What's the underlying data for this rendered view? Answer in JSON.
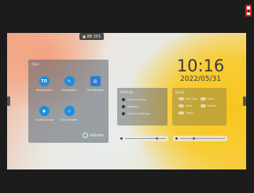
{
  "header": {
    "label": "88 201"
  },
  "clock": {
    "time": "10:16",
    "date": "2022/05/31"
  },
  "apps_panel": {
    "title": "Apps",
    "apps": [
      {
        "icon_text": "TO",
        "label": "Whiteboard",
        "icon": "whiteboard-icon"
      },
      {
        "icon_text": "✎",
        "label": "Annotation",
        "icon": "pen-icon"
      },
      {
        "icon_text": "▤",
        "label": "File Manager",
        "icon": "folder-icon"
      },
      {
        "icon_text": "◉",
        "label": "Screen Share",
        "icon": "share-icon"
      },
      {
        "icon_text": "▭",
        "label": "File Transfer",
        "icon": "file-icon"
      }
    ],
    "brand": "eShare"
  },
  "info_panel": {
    "title": "Settings",
    "rows": [
      "Signal Source",
      "Network",
      "System Settings"
    ]
  },
  "light_panel": {
    "title": "Quick",
    "toggles": [
      "Eye Care",
      "Lock",
      "Mute",
      "Freeze",
      "Timer"
    ]
  },
  "sliders": {
    "volume_value": 0.78,
    "brightness_value": 0.3
  },
  "colors": {
    "accent": "#1a8fe0",
    "highlight": "#e21b1b"
  }
}
